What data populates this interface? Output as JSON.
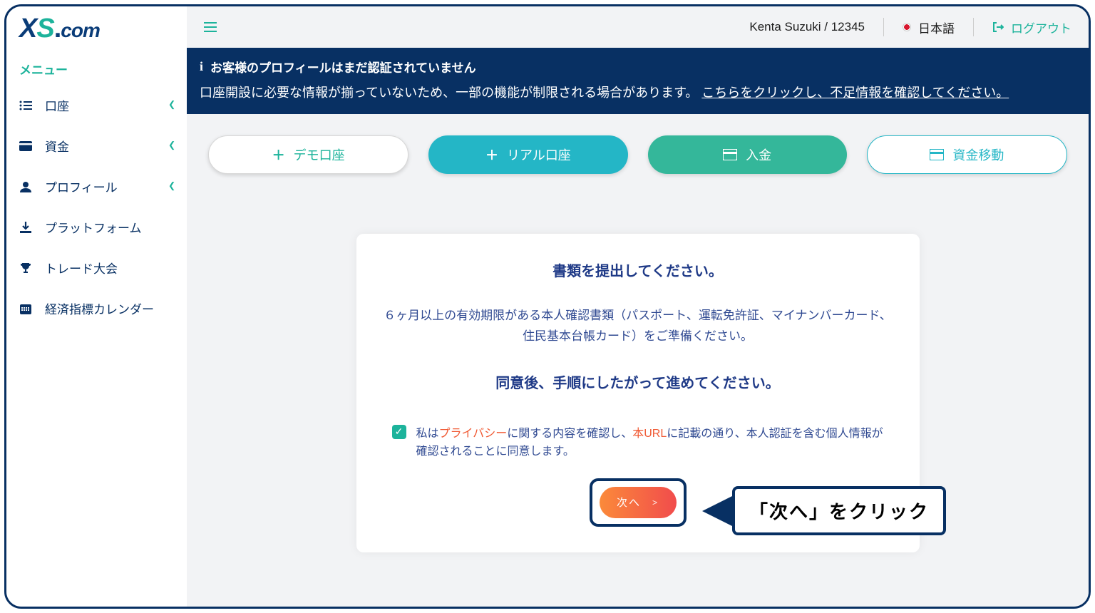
{
  "header": {
    "user_text": "Kenta Suzuki / 12345",
    "language": "日本語",
    "logout": "ログアウト"
  },
  "sidebar": {
    "menu_label": "メニュー",
    "items": [
      {
        "label": "口座",
        "expandable": true
      },
      {
        "label": "資金",
        "expandable": true
      },
      {
        "label": "プロフィール",
        "expandable": true
      },
      {
        "label": "プラットフォーム",
        "expandable": false
      },
      {
        "label": "トレード大会",
        "expandable": false
      },
      {
        "label": "経済指標カレンダー",
        "expandable": false
      }
    ]
  },
  "banner": {
    "title": "お客様のプロフィールはまだ認証されていません",
    "desc_prefix": "口座開設に必要な情報が揃っていないため、一部の機能が制限される場合があります。 ",
    "desc_link": "こちらをクリックし、不足情報を確認してください。"
  },
  "actions": {
    "demo": "デモ口座",
    "real": "リアル口座",
    "deposit": "入金",
    "transfer": "資金移動"
  },
  "card": {
    "h1": "書類を提出してください。",
    "p1": "６ヶ月以上の有効期限がある本人確認書類（パスポート、運転免許証、マイナンバーカード、住民基本台帳カード）をご準備ください。",
    "h2": "同意後、手順にしたがって進めてください。",
    "consent_pre": "私は",
    "consent_em1": "プライバシー",
    "consent_mid": "に関する内容を確認し、",
    "consent_em2": "本URL",
    "consent_post": "に記載の通り、本人認証を含む個人情報が確認されることに同意します。",
    "next": "次へ",
    "next_arrow": ">"
  },
  "callout": {
    "text": "「次へ」をクリック"
  }
}
